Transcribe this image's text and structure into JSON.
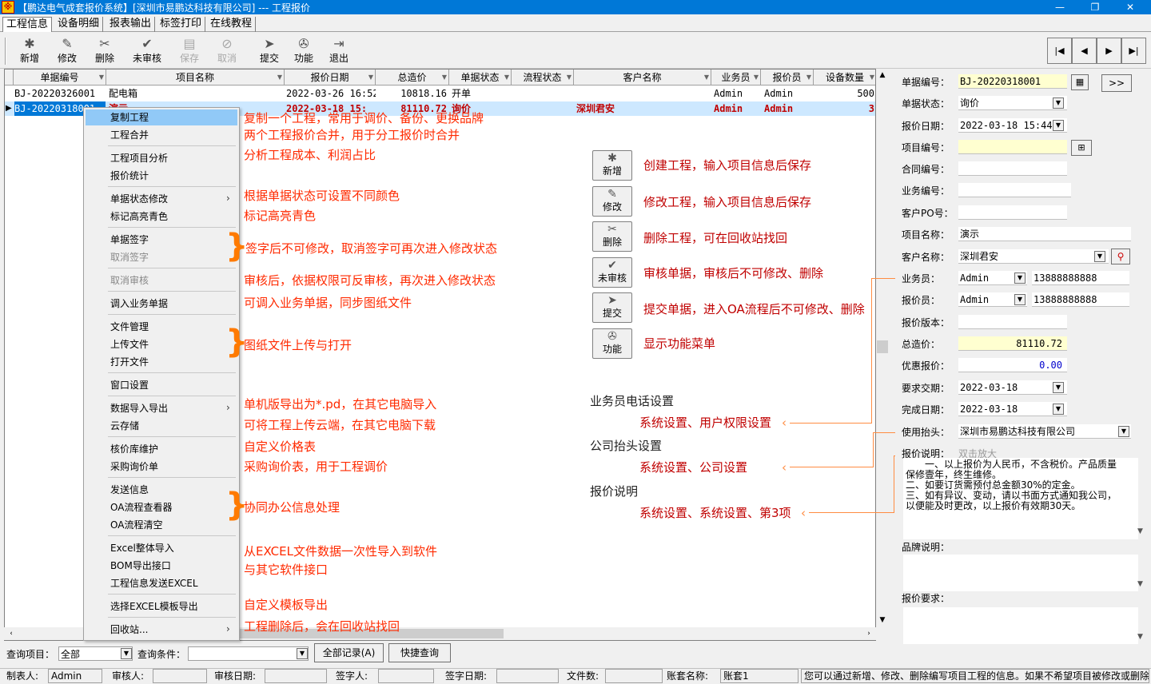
{
  "window": {
    "title": "【鹏达电气成套报价系统】[深圳市易鹏达科技有限公司] --- 工程报价",
    "min": "—",
    "max": "❐",
    "close": "✕"
  },
  "menu": [
    "工程信息",
    "设备明细",
    "报表输出",
    "标签打印",
    "在线教程"
  ],
  "toolbar": [
    {
      "label": "新增",
      "icon": "new-icon",
      "glyph": "✱",
      "enabled": true
    },
    {
      "label": "修改",
      "icon": "edit-icon",
      "glyph": "✎",
      "enabled": true
    },
    {
      "label": "删除",
      "icon": "delete-icon",
      "glyph": "✂",
      "enabled": true
    },
    {
      "label": "未审核",
      "icon": "check-icon",
      "glyph": "✔",
      "enabled": true
    },
    {
      "label": "保存",
      "icon": "save-icon",
      "glyph": "▤",
      "enabled": false
    },
    {
      "label": "取消",
      "icon": "cancel-icon",
      "glyph": "⊘",
      "enabled": false
    },
    {
      "label": "提交",
      "icon": "submit-icon",
      "glyph": "➤",
      "enabled": true
    },
    {
      "label": "功能",
      "icon": "function-icon",
      "glyph": "✇",
      "enabled": true
    },
    {
      "label": "退出",
      "icon": "exit-icon",
      "glyph": "⇥",
      "enabled": true
    }
  ],
  "nav": [
    "|◀",
    "◀",
    "▶",
    "▶|"
  ],
  "grid": {
    "columns": [
      "单据编号",
      "项目名称",
      "报价日期",
      "总造价",
      "单据状态",
      "流程状态",
      "客户名称",
      "业务员",
      "报价员",
      "设备数量"
    ],
    "rows": [
      [
        "BJ-20220326001",
        "配电箱",
        "2022-03-26 16:52",
        "10818.16",
        "开单",
        "",
        "",
        "Admin",
        "Admin",
        "500"
      ],
      [
        "BJ-20220318001",
        "演示",
        "2022-03-18 15:",
        "81110.72",
        "询价",
        "",
        "深圳君安",
        "Admin",
        "Admin",
        "3"
      ]
    ]
  },
  "context_menu": {
    "items": [
      {
        "label": "复制工程"
      },
      {
        "label": "工程合并"
      },
      {
        "label": "工程项目分析"
      },
      {
        "label": "报价统计"
      },
      {
        "label": "单据状态修改",
        "arrow": "›"
      },
      {
        "label": "标记高亮青色"
      },
      {
        "label": "单据签字"
      },
      {
        "label": "取消签字",
        "disabled": true
      },
      {
        "label": "取消审核",
        "disabled": true
      },
      {
        "label": "调入业务单据"
      },
      {
        "label": "文件管理"
      },
      {
        "label": "上传文件"
      },
      {
        "label": "打开文件"
      },
      {
        "label": "窗口设置"
      },
      {
        "label": "数据导入导出",
        "arrow": "›"
      },
      {
        "label": "云存储"
      },
      {
        "label": "核价库维护"
      },
      {
        "label": "采购询价单"
      },
      {
        "label": "发送信息"
      },
      {
        "label": "OA流程查看器"
      },
      {
        "label": "OA流程清空"
      },
      {
        "label": "Excel整体导入"
      },
      {
        "label": "BOM导出接口"
      },
      {
        "label": "工程信息发送EXCEL"
      },
      {
        "label": "选择EXCEL模板导出"
      },
      {
        "label": "回收站...",
        "arrow": "›"
      }
    ]
  },
  "annotations": {
    "menu": [
      "复制一个工程，常用于调价、备份、更换品牌",
      "两个工程报价合并，用于分工报价时合并",
      "分析工程成本、利润占比",
      "根据单据状态可设置不同颜色",
      "标记高亮青色",
      "签字后不可修改，取消签字可再次进入修改状态",
      "审核后，依据权限可反审核，再次进入修改状态",
      "可调入业务单据，同步图纸文件",
      "图纸文件上传与打开",
      "单机版导出为*.pd，在其它电脑导入",
      "可将工程上传云端，在其它电脑下载",
      "自定义价格表",
      "采购询价表，用于工程调价",
      "协同办公信息处理",
      "从EXCEL文件数据一次性导入到软件",
      "与其它软件接口",
      "自定义模板导出",
      "工程删除后，会在回收站找回"
    ],
    "buttons": [
      {
        "label": "新增",
        "icon": "new-icon",
        "glyph": "✱",
        "desc": "创建工程，输入项目信息后保存"
      },
      {
        "label": "修改",
        "icon": "edit-icon",
        "glyph": "✎",
        "desc": "修改工程，输入项目信息后保存"
      },
      {
        "label": "删除",
        "icon": "delete-icon",
        "glyph": "✂",
        "desc": "删除工程，可在回收站找回"
      },
      {
        "label": "未审核",
        "icon": "check-icon",
        "glyph": "✔",
        "desc": "审核单据，审核后不可修改、删除"
      },
      {
        "label": "提交",
        "icon": "submit-icon",
        "glyph": "➤",
        "desc": "提交单据，进入OA流程后不可修改、删除"
      },
      {
        "label": "功能",
        "icon": "function-icon",
        "glyph": "✇",
        "desc": "显示功能菜单"
      }
    ],
    "sections": [
      {
        "title": "业务员电话设置",
        "path": "系统设置、用户权限设置"
      },
      {
        "title": "公司抬头设置",
        "path": "系统设置、公司设置"
      },
      {
        "title": "报价说明",
        "path": "系统设置、系统设置、第3项"
      }
    ]
  },
  "form": {
    "doc_no": {
      "label": "单据编号：",
      "value": "BJ-20220318001"
    },
    "expand_btn": ">>",
    "status": {
      "label": "单据状态：",
      "value": "询价"
    },
    "date": {
      "label": "报价日期：",
      "value": "2022-03-18 15:44"
    },
    "project_no": {
      "label": "项目编号：",
      "value": ""
    },
    "contract_no": {
      "label": "合同编号：",
      "value": ""
    },
    "business_no": {
      "label": "业务编号：",
      "value": ""
    },
    "customer_po": {
      "label": "客户PO号：",
      "value": ""
    },
    "project_name": {
      "label": "项目名称：",
      "value": "演示"
    },
    "customer_name": {
      "label": "客户名称：",
      "value": "深圳君安"
    },
    "salesman": {
      "label": "业务员：",
      "value": "Admin",
      "phone": "13888888888"
    },
    "quoter": {
      "label": "报价员：",
      "value": "Admin",
      "phone": "13888888888"
    },
    "version": {
      "label": "报价版本：",
      "value": ""
    },
    "total": {
      "label": "总造价：",
      "value": "81110.72"
    },
    "discount": {
      "label": "优惠报价：",
      "value": "0.00"
    },
    "delivery": {
      "label": "要求交期：",
      "value": "2022-03-18"
    },
    "finish": {
      "label": "完成日期：",
      "value": "2022-03-18"
    },
    "header": {
      "label": "使用抬头：",
      "value": "深圳市易鹏达科技有限公司"
    },
    "note": {
      "label": "报价说明：",
      "hint": "双击放大",
      "lines": [
        "　　一、以上报价为人民币，不含税价。产品质量",
        "保修壹年，终生维修。",
        "二、如要订货需预付总金额30%的定金。",
        "三、如有异议、变动，请以书面方式通知我公司，",
        "以便能及时更改，以上报价有效期30天。"
      ]
    },
    "brand_note": {
      "label": "品牌说明："
    },
    "requirement": {
      "label": "报价要求："
    }
  },
  "query": {
    "field_label": "查询项目：",
    "field_value": "全部",
    "cond_label": "查询条件：",
    "cond_value": "",
    "all_btn": "全部记录(A)",
    "quick_btn": "快捷查询"
  },
  "status": {
    "maker_label": "制表人:",
    "maker": "Admin",
    "auditor_label": "审核人:",
    "auditor": "",
    "audit_date_label": "审核日期:",
    "audit_date": "",
    "signer_label": "签字人:",
    "signer": "",
    "sign_date_label": "签字日期:",
    "sign_date": "",
    "files_label": "文件数:",
    "files": "",
    "account_label": "账套名称:",
    "account": "账套1",
    "message": "您可以通过新增、修改、删除编写项目工程的信息。如果不希望项目被修改或删除,"
  }
}
